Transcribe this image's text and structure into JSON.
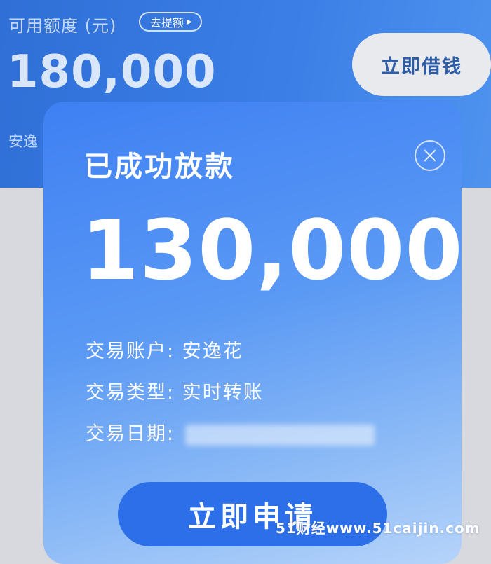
{
  "header": {
    "credit_label": "可用额度 (元)",
    "raise_button_label": "去提额",
    "credit_amount": "180,000",
    "borrow_button_label": "立即借钱",
    "partial_label": "安逸"
  },
  "modal": {
    "title": "已成功放款",
    "amount": "130,000",
    "fields": [
      {
        "label": "交易账户:",
        "value": "安逸花"
      },
      {
        "label": "交易类型:",
        "value": "实时转账"
      },
      {
        "label": "交易日期:",
        "value": ""
      }
    ],
    "apply_button_label": "立即申请"
  },
  "watermark": "51财经www.51caijin.com"
}
